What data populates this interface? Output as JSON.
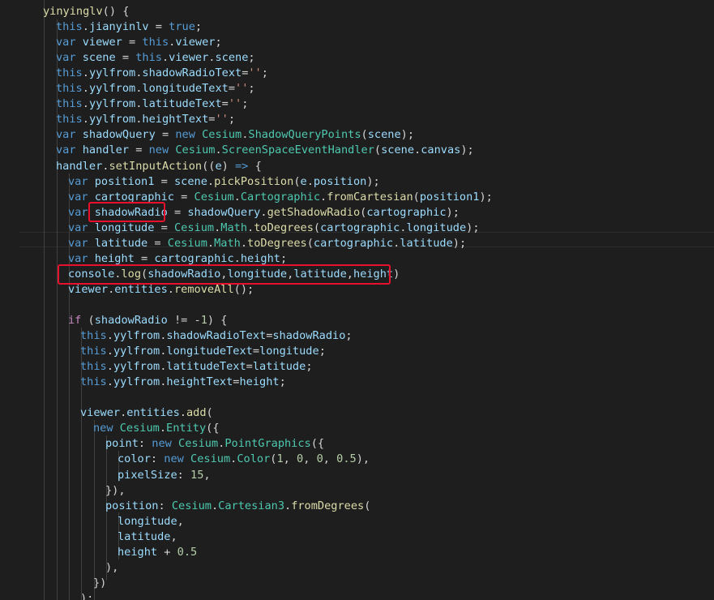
{
  "editor": {
    "language": "javascript",
    "highlight_color": "#e8112d",
    "lines": [
      [
        {
          "t": "yinyinglv",
          "c": "fn"
        },
        {
          "t": "() {",
          "c": "plain"
        }
      ],
      [
        {
          "t": "this",
          "c": "kw"
        },
        {
          "t": ".",
          "c": "plain"
        },
        {
          "t": "jianyinlv",
          "c": "var"
        },
        {
          "t": " = ",
          "c": "plain"
        },
        {
          "t": "true",
          "c": "kw"
        },
        {
          "t": ";",
          "c": "plain"
        }
      ],
      [
        {
          "t": "var",
          "c": "kw"
        },
        {
          "t": " ",
          "c": "plain"
        },
        {
          "t": "viewer",
          "c": "var"
        },
        {
          "t": " = ",
          "c": "plain"
        },
        {
          "t": "this",
          "c": "kw"
        },
        {
          "t": ".",
          "c": "plain"
        },
        {
          "t": "viewer",
          "c": "var"
        },
        {
          "t": ";",
          "c": "plain"
        }
      ],
      [
        {
          "t": "var",
          "c": "kw"
        },
        {
          "t": " ",
          "c": "plain"
        },
        {
          "t": "scene",
          "c": "var"
        },
        {
          "t": " = ",
          "c": "plain"
        },
        {
          "t": "this",
          "c": "kw"
        },
        {
          "t": ".",
          "c": "plain"
        },
        {
          "t": "viewer",
          "c": "var"
        },
        {
          "t": ".",
          "c": "plain"
        },
        {
          "t": "scene",
          "c": "var"
        },
        {
          "t": ";",
          "c": "plain"
        }
      ],
      [
        {
          "t": "this",
          "c": "kw"
        },
        {
          "t": ".",
          "c": "plain"
        },
        {
          "t": "yylfrom",
          "c": "var"
        },
        {
          "t": ".",
          "c": "plain"
        },
        {
          "t": "shadowRadioText",
          "c": "var"
        },
        {
          "t": "=",
          "c": "plain"
        },
        {
          "t": "''",
          "c": "str"
        },
        {
          "t": ";",
          "c": "plain"
        }
      ],
      [
        {
          "t": "this",
          "c": "kw"
        },
        {
          "t": ".",
          "c": "plain"
        },
        {
          "t": "yylfrom",
          "c": "var"
        },
        {
          "t": ".",
          "c": "plain"
        },
        {
          "t": "longitudeText",
          "c": "var"
        },
        {
          "t": "=",
          "c": "plain"
        },
        {
          "t": "''",
          "c": "str"
        },
        {
          "t": ";",
          "c": "plain"
        }
      ],
      [
        {
          "t": "this",
          "c": "kw"
        },
        {
          "t": ".",
          "c": "plain"
        },
        {
          "t": "yylfrom",
          "c": "var"
        },
        {
          "t": ".",
          "c": "plain"
        },
        {
          "t": "latitudeText",
          "c": "var"
        },
        {
          "t": "=",
          "c": "plain"
        },
        {
          "t": "''",
          "c": "str"
        },
        {
          "t": ";",
          "c": "plain"
        }
      ],
      [
        {
          "t": "this",
          "c": "kw"
        },
        {
          "t": ".",
          "c": "plain"
        },
        {
          "t": "yylfrom",
          "c": "var"
        },
        {
          "t": ".",
          "c": "plain"
        },
        {
          "t": "heightText",
          "c": "var"
        },
        {
          "t": "=",
          "c": "plain"
        },
        {
          "t": "''",
          "c": "str"
        },
        {
          "t": ";",
          "c": "plain"
        }
      ],
      [
        {
          "t": "var",
          "c": "kw"
        },
        {
          "t": " ",
          "c": "plain"
        },
        {
          "t": "shadowQuery",
          "c": "var"
        },
        {
          "t": " = ",
          "c": "plain"
        },
        {
          "t": "new",
          "c": "kw"
        },
        {
          "t": " ",
          "c": "plain"
        },
        {
          "t": "Cesium",
          "c": "cls"
        },
        {
          "t": ".",
          "c": "plain"
        },
        {
          "t": "ShadowQueryPoints",
          "c": "cls"
        },
        {
          "t": "(",
          "c": "plain"
        },
        {
          "t": "scene",
          "c": "var"
        },
        {
          "t": ");",
          "c": "plain"
        }
      ],
      [
        {
          "t": "var",
          "c": "kw"
        },
        {
          "t": " ",
          "c": "plain"
        },
        {
          "t": "handler",
          "c": "var"
        },
        {
          "t": " = ",
          "c": "plain"
        },
        {
          "t": "new",
          "c": "kw"
        },
        {
          "t": " ",
          "c": "plain"
        },
        {
          "t": "Cesium",
          "c": "cls"
        },
        {
          "t": ".",
          "c": "plain"
        },
        {
          "t": "ScreenSpaceEventHandler",
          "c": "cls"
        },
        {
          "t": "(",
          "c": "plain"
        },
        {
          "t": "scene",
          "c": "var"
        },
        {
          "t": ".",
          "c": "plain"
        },
        {
          "t": "canvas",
          "c": "var"
        },
        {
          "t": ");",
          "c": "plain"
        }
      ],
      [
        {
          "t": "handler",
          "c": "var"
        },
        {
          "t": ".",
          "c": "plain"
        },
        {
          "t": "setInputAction",
          "c": "fn"
        },
        {
          "t": "((",
          "c": "plain"
        },
        {
          "t": "e",
          "c": "var"
        },
        {
          "t": ") ",
          "c": "plain"
        },
        {
          "t": "=>",
          "c": "kw"
        },
        {
          "t": " ",
          "c": "plain"
        },
        {
          "t": "{",
          "c": "brk"
        }
      ],
      [
        {
          "t": "var",
          "c": "kw"
        },
        {
          "t": " ",
          "c": "plain"
        },
        {
          "t": "position1",
          "c": "var"
        },
        {
          "t": " = ",
          "c": "plain"
        },
        {
          "t": "scene",
          "c": "var"
        },
        {
          "t": ".",
          "c": "plain"
        },
        {
          "t": "pickPosition",
          "c": "fn"
        },
        {
          "t": "(",
          "c": "plain"
        },
        {
          "t": "e",
          "c": "var"
        },
        {
          "t": ".",
          "c": "plain"
        },
        {
          "t": "position",
          "c": "var"
        },
        {
          "t": ");",
          "c": "plain"
        }
      ],
      [
        {
          "t": "var",
          "c": "kw"
        },
        {
          "t": " ",
          "c": "plain"
        },
        {
          "t": "cartographic",
          "c": "var"
        },
        {
          "t": " = ",
          "c": "plain"
        },
        {
          "t": "Cesium",
          "c": "cls"
        },
        {
          "t": ".",
          "c": "plain"
        },
        {
          "t": "Cartographic",
          "c": "cls"
        },
        {
          "t": ".",
          "c": "plain"
        },
        {
          "t": "fromCartesian",
          "c": "fn"
        },
        {
          "t": "(",
          "c": "plain"
        },
        {
          "t": "position1",
          "c": "var"
        },
        {
          "t": ");",
          "c": "plain"
        }
      ],
      [
        {
          "t": "var",
          "c": "kw"
        },
        {
          "t": " ",
          "c": "plain"
        },
        {
          "t": "shadowRadio",
          "c": "var"
        },
        {
          "t": " = ",
          "c": "plain"
        },
        {
          "t": "shadowQuery",
          "c": "var"
        },
        {
          "t": ".",
          "c": "plain"
        },
        {
          "t": "getShadowRadio",
          "c": "fn"
        },
        {
          "t": "(",
          "c": "plain"
        },
        {
          "t": "cartographic",
          "c": "var"
        },
        {
          "t": ");",
          "c": "plain"
        }
      ],
      [
        {
          "t": "var",
          "c": "kw"
        },
        {
          "t": " ",
          "c": "plain"
        },
        {
          "t": "longitude",
          "c": "var"
        },
        {
          "t": " = ",
          "c": "plain"
        },
        {
          "t": "Cesium",
          "c": "cls"
        },
        {
          "t": ".",
          "c": "plain"
        },
        {
          "t": "Math",
          "c": "cls"
        },
        {
          "t": ".",
          "c": "plain"
        },
        {
          "t": "toDegrees",
          "c": "fn"
        },
        {
          "t": "(",
          "c": "plain"
        },
        {
          "t": "cartographic",
          "c": "var"
        },
        {
          "t": ".",
          "c": "plain"
        },
        {
          "t": "longitude",
          "c": "var"
        },
        {
          "t": ");",
          "c": "plain"
        }
      ],
      [
        {
          "t": "var",
          "c": "kw"
        },
        {
          "t": " ",
          "c": "plain"
        },
        {
          "t": "latitude",
          "c": "var"
        },
        {
          "t": " = ",
          "c": "plain"
        },
        {
          "t": "Cesium",
          "c": "cls"
        },
        {
          "t": ".",
          "c": "plain"
        },
        {
          "t": "Math",
          "c": "cls"
        },
        {
          "t": ".",
          "c": "plain"
        },
        {
          "t": "toDegrees",
          "c": "fn"
        },
        {
          "t": "(",
          "c": "plain"
        },
        {
          "t": "cartographic",
          "c": "var"
        },
        {
          "t": ".",
          "c": "plain"
        },
        {
          "t": "latitude",
          "c": "var"
        },
        {
          "t": ");",
          "c": "plain"
        }
      ],
      [
        {
          "t": "var",
          "c": "kw"
        },
        {
          "t": " ",
          "c": "plain"
        },
        {
          "t": "height",
          "c": "var"
        },
        {
          "t": " = ",
          "c": "plain"
        },
        {
          "t": "cartographic",
          "c": "var"
        },
        {
          "t": ".",
          "c": "plain"
        },
        {
          "t": "height",
          "c": "var"
        },
        {
          "t": ";",
          "c": "plain"
        }
      ],
      [
        {
          "t": "console",
          "c": "var"
        },
        {
          "t": ".",
          "c": "plain"
        },
        {
          "t": "log",
          "c": "fn"
        },
        {
          "t": "(",
          "c": "plain"
        },
        {
          "t": "shadowRadio",
          "c": "var"
        },
        {
          "t": ",",
          "c": "plain"
        },
        {
          "t": "longitude",
          "c": "var"
        },
        {
          "t": ",",
          "c": "plain"
        },
        {
          "t": "latitude",
          "c": "var"
        },
        {
          "t": ",",
          "c": "plain"
        },
        {
          "t": "height",
          "c": "var"
        },
        {
          "t": ")",
          "c": "plain"
        }
      ],
      [
        {
          "t": "viewer",
          "c": "var"
        },
        {
          "t": ".",
          "c": "plain"
        },
        {
          "t": "entities",
          "c": "var"
        },
        {
          "t": ".",
          "c": "plain"
        },
        {
          "t": "removeAll",
          "c": "fn"
        },
        {
          "t": "();",
          "c": "plain"
        }
      ],
      [],
      [
        {
          "t": "if",
          "c": "ctl"
        },
        {
          "t": " (",
          "c": "plain"
        },
        {
          "t": "shadowRadio",
          "c": "var"
        },
        {
          "t": " != -",
          "c": "plain"
        },
        {
          "t": "1",
          "c": "num"
        },
        {
          "t": ") {",
          "c": "plain"
        }
      ],
      [
        {
          "t": "this",
          "c": "kw"
        },
        {
          "t": ".",
          "c": "plain"
        },
        {
          "t": "yylfrom",
          "c": "var"
        },
        {
          "t": ".",
          "c": "plain"
        },
        {
          "t": "shadowRadioText",
          "c": "var"
        },
        {
          "t": "=",
          "c": "plain"
        },
        {
          "t": "shadowRadio",
          "c": "var"
        },
        {
          "t": ";",
          "c": "plain"
        }
      ],
      [
        {
          "t": "this",
          "c": "kw"
        },
        {
          "t": ".",
          "c": "plain"
        },
        {
          "t": "yylfrom",
          "c": "var"
        },
        {
          "t": ".",
          "c": "plain"
        },
        {
          "t": "longitudeText",
          "c": "var"
        },
        {
          "t": "=",
          "c": "plain"
        },
        {
          "t": "longitude",
          "c": "var"
        },
        {
          "t": ";",
          "c": "plain"
        }
      ],
      [
        {
          "t": "this",
          "c": "kw"
        },
        {
          "t": ".",
          "c": "plain"
        },
        {
          "t": "yylfrom",
          "c": "var"
        },
        {
          "t": ".",
          "c": "plain"
        },
        {
          "t": "latitudeText",
          "c": "var"
        },
        {
          "t": "=",
          "c": "plain"
        },
        {
          "t": "latitude",
          "c": "var"
        },
        {
          "t": ";",
          "c": "plain"
        }
      ],
      [
        {
          "t": "this",
          "c": "kw"
        },
        {
          "t": ".",
          "c": "plain"
        },
        {
          "t": "yylfrom",
          "c": "var"
        },
        {
          "t": ".",
          "c": "plain"
        },
        {
          "t": "heightText",
          "c": "var"
        },
        {
          "t": "=",
          "c": "plain"
        },
        {
          "t": "height",
          "c": "var"
        },
        {
          "t": ";",
          "c": "plain"
        }
      ],
      [],
      [
        {
          "t": "viewer",
          "c": "var"
        },
        {
          "t": ".",
          "c": "plain"
        },
        {
          "t": "entities",
          "c": "var"
        },
        {
          "t": ".",
          "c": "plain"
        },
        {
          "t": "add",
          "c": "fn"
        },
        {
          "t": "(",
          "c": "plain"
        }
      ],
      [
        {
          "t": "new",
          "c": "kw"
        },
        {
          "t": " ",
          "c": "plain"
        },
        {
          "t": "Cesium",
          "c": "cls"
        },
        {
          "t": ".",
          "c": "plain"
        },
        {
          "t": "Entity",
          "c": "cls"
        },
        {
          "t": "({",
          "c": "plain"
        }
      ],
      [
        {
          "t": "point",
          "c": "var"
        },
        {
          "t": ": ",
          "c": "plain"
        },
        {
          "t": "new",
          "c": "kw"
        },
        {
          "t": " ",
          "c": "plain"
        },
        {
          "t": "Cesium",
          "c": "cls"
        },
        {
          "t": ".",
          "c": "plain"
        },
        {
          "t": "PointGraphics",
          "c": "cls"
        },
        {
          "t": "({",
          "c": "plain"
        }
      ],
      [
        {
          "t": "color",
          "c": "var"
        },
        {
          "t": ": ",
          "c": "plain"
        },
        {
          "t": "new",
          "c": "kw"
        },
        {
          "t": " ",
          "c": "plain"
        },
        {
          "t": "Cesium",
          "c": "cls"
        },
        {
          "t": ".",
          "c": "plain"
        },
        {
          "t": "Color",
          "c": "cls"
        },
        {
          "t": "(",
          "c": "plain"
        },
        {
          "t": "1",
          "c": "num"
        },
        {
          "t": ", ",
          "c": "plain"
        },
        {
          "t": "0",
          "c": "num"
        },
        {
          "t": ", ",
          "c": "plain"
        },
        {
          "t": "0",
          "c": "num"
        },
        {
          "t": ", ",
          "c": "plain"
        },
        {
          "t": "0.5",
          "c": "num"
        },
        {
          "t": "),",
          "c": "plain"
        }
      ],
      [
        {
          "t": "pixelSize",
          "c": "var"
        },
        {
          "t": ": ",
          "c": "plain"
        },
        {
          "t": "15",
          "c": "num"
        },
        {
          "t": ",",
          "c": "plain"
        }
      ],
      [
        {
          "t": "}),",
          "c": "plain"
        }
      ],
      [
        {
          "t": "position",
          "c": "var"
        },
        {
          "t": ": ",
          "c": "plain"
        },
        {
          "t": "Cesium",
          "c": "cls"
        },
        {
          "t": ".",
          "c": "plain"
        },
        {
          "t": "Cartesian3",
          "c": "cls"
        },
        {
          "t": ".",
          "c": "plain"
        },
        {
          "t": "fromDegrees",
          "c": "fn"
        },
        {
          "t": "(",
          "c": "plain"
        }
      ],
      [
        {
          "t": "longitude",
          "c": "var"
        },
        {
          "t": ",",
          "c": "plain"
        }
      ],
      [
        {
          "t": "latitude",
          "c": "var"
        },
        {
          "t": ",",
          "c": "plain"
        }
      ],
      [
        {
          "t": "height",
          "c": "var"
        },
        {
          "t": " + ",
          "c": "plain"
        },
        {
          "t": "0.5",
          "c": "num"
        }
      ],
      [
        {
          "t": "),",
          "c": "plain"
        }
      ],
      [
        {
          "t": "})",
          "c": "plain"
        }
      ],
      [
        {
          "t": ");",
          "c": "plain"
        }
      ]
    ]
  }
}
